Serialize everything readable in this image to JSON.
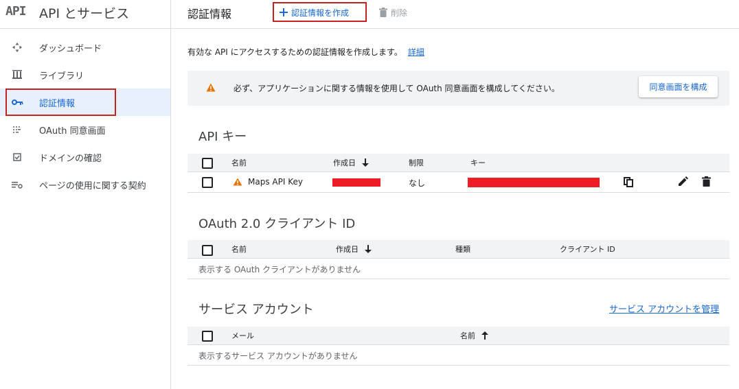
{
  "sidebar": {
    "logo": "API",
    "title": "API とサービス",
    "items": [
      {
        "label": "ダッシュボード",
        "icon": "dashboard-icon"
      },
      {
        "label": "ライブラリ",
        "icon": "library-icon"
      },
      {
        "label": "認証情報",
        "icon": "key-icon",
        "active": true
      },
      {
        "label": "OAuth 同意画面",
        "icon": "oauth-consent-icon"
      },
      {
        "label": "ドメインの確認",
        "icon": "checkbox-icon"
      },
      {
        "label": "ページの使用に関する契約",
        "icon": "settings-list-icon"
      }
    ]
  },
  "header": {
    "title": "認証情報",
    "create_label": "認証情報を作成",
    "delete_label": "削除"
  },
  "intro": {
    "text": "有効な API にアクセスするための認証情報を作成します。",
    "link": "詳細"
  },
  "banner": {
    "text": "必ず、アプリケーションに関する情報を使用して OAuth 同意画面を構成してください。",
    "button": "同意画面を構成"
  },
  "api_keys": {
    "title": "API キー",
    "columns": [
      "名前",
      "作成日",
      "制限",
      "キー"
    ],
    "rows": [
      {
        "name": "Maps API Key",
        "restriction": "なし"
      }
    ]
  },
  "oauth": {
    "title": "OAuth 2.0 クライアント ID",
    "columns": [
      "名前",
      "作成日",
      "種類",
      "クライアント ID"
    ],
    "empty": "表示する OAuth クライアントがありません"
  },
  "service_accounts": {
    "title": "サービス アカウント",
    "manage_link": "サービス アカウントを管理",
    "columns": [
      "メール",
      "名前"
    ],
    "empty": "表示するサービス アカウントがありません"
  },
  "colors": {
    "accent": "#1967d2",
    "highlight": "#c5221f",
    "warning": "#e37400",
    "redaction": "#ee1c24"
  }
}
